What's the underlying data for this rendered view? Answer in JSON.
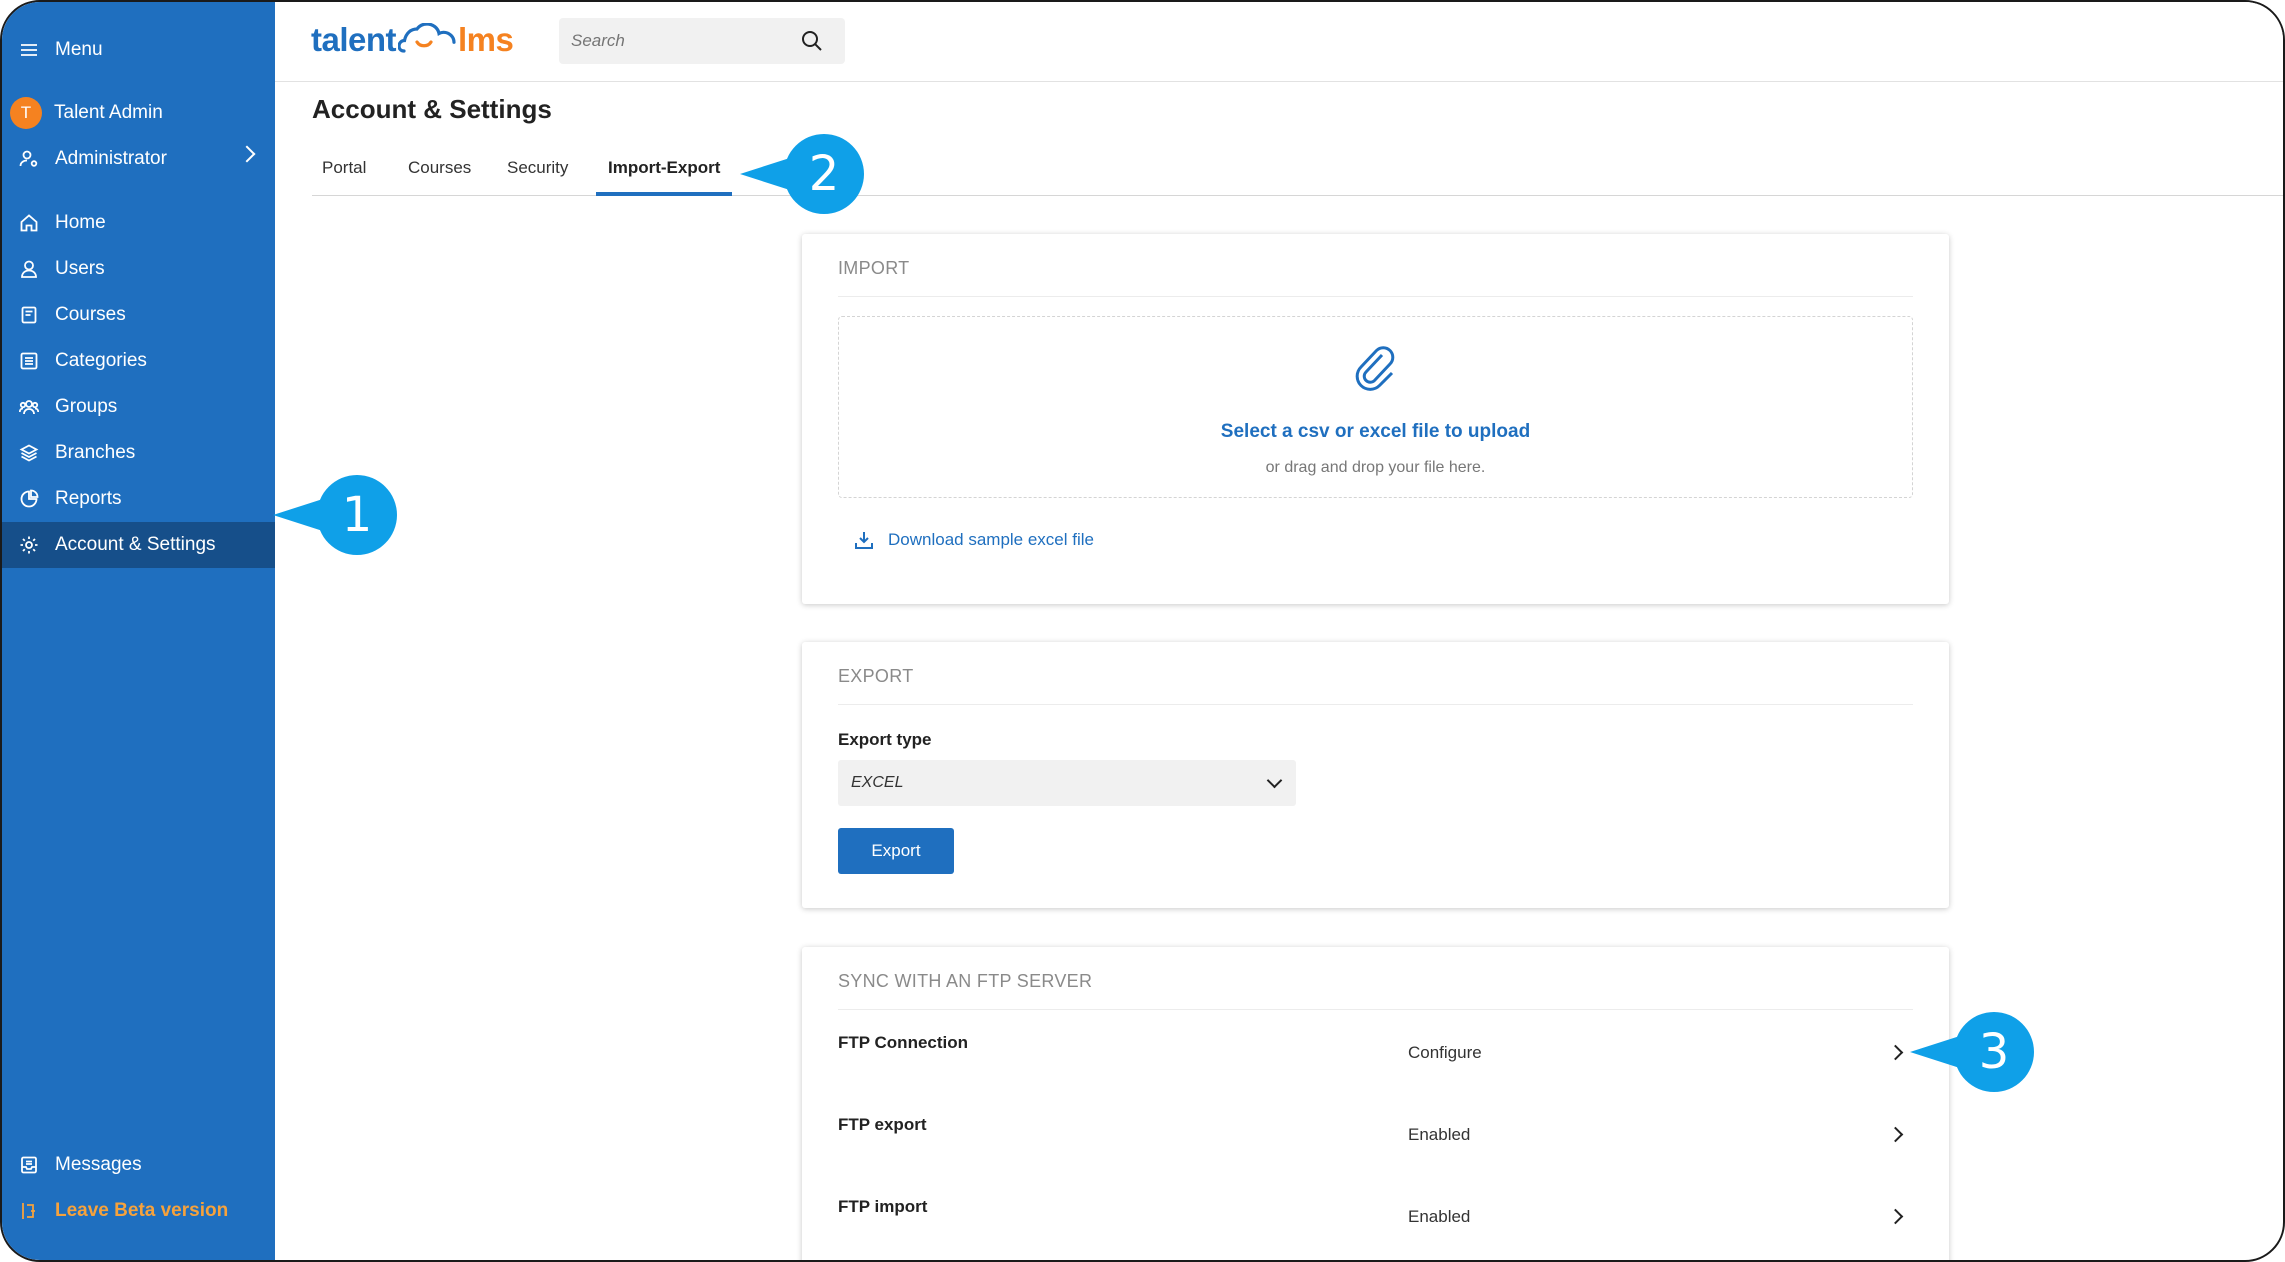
{
  "sidebar": {
    "menu_label": "Menu",
    "user_name": "Talent Admin",
    "user_initial": "T",
    "role": "Administrator",
    "items": [
      {
        "label": "Home"
      },
      {
        "label": "Users"
      },
      {
        "label": "Courses"
      },
      {
        "label": "Categories"
      },
      {
        "label": "Groups"
      },
      {
        "label": "Branches"
      },
      {
        "label": "Reports"
      },
      {
        "label": "Account & Settings"
      }
    ],
    "messages_label": "Messages",
    "beta_label": "Leave Beta version"
  },
  "header": {
    "logo_left": "talent",
    "logo_right": "lms",
    "search_placeholder": "Search"
  },
  "page": {
    "title": "Account & Settings",
    "tabs": [
      "Portal",
      "Courses",
      "Security",
      "Import-Export"
    ],
    "active_tab": "Import-Export"
  },
  "import": {
    "title": "IMPORT",
    "select_text": "Select a csv or excel file to upload",
    "drag_text": "or drag and drop your file here.",
    "download_link": "Download sample excel file"
  },
  "export": {
    "title": "EXPORT",
    "type_label": "Export type",
    "type_value": "EXCEL",
    "button": "Export"
  },
  "ftp": {
    "title": "SYNC WITH AN FTP SERVER",
    "rows": [
      {
        "name": "FTP Connection",
        "value": "Configure"
      },
      {
        "name": "FTP export",
        "value": "Enabled"
      },
      {
        "name": "FTP import",
        "value": "Enabled"
      }
    ]
  },
  "callouts": [
    "1",
    "2",
    "3"
  ],
  "colors": {
    "brand_blue": "#1f6fbf",
    "brand_orange": "#f58220",
    "callout": "#0fa0e8",
    "sidebar_active": "#164f8a"
  }
}
